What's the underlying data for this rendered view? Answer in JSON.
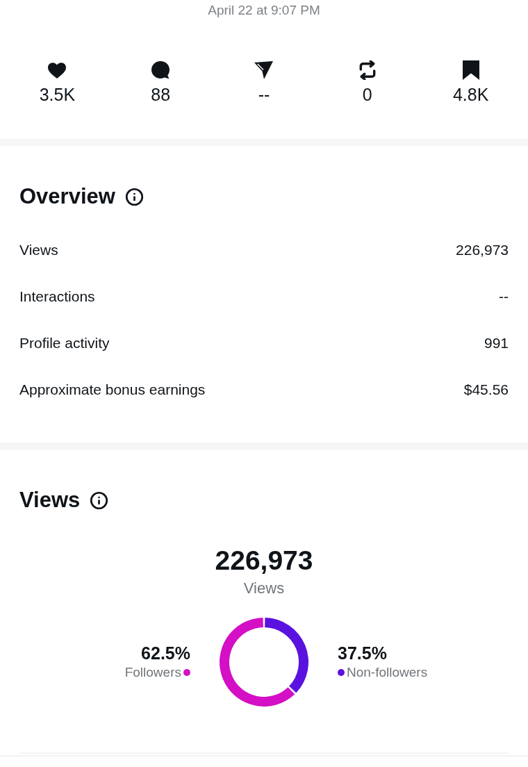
{
  "post_time": "April 22 at 9:07 PM",
  "stats": [
    {
      "kind": "likes",
      "value": "3.5K"
    },
    {
      "kind": "comments",
      "value": "88"
    },
    {
      "kind": "shares",
      "value": "--"
    },
    {
      "kind": "reposts",
      "value": "0"
    },
    {
      "kind": "saves",
      "value": "4.8K"
    }
  ],
  "overview": {
    "title": "Overview",
    "rows": [
      {
        "label": "Views",
        "value": "226,973"
      },
      {
        "label": "Interactions",
        "value": "--"
      },
      {
        "label": "Profile activity",
        "value": "991"
      },
      {
        "label": "Approximate bonus earnings",
        "value": "$45.56"
      }
    ]
  },
  "views": {
    "title": "Views",
    "total": "226,973",
    "chart_data": {
      "type": "donut",
      "categories": [
        "Followers",
        "Non-followers"
      ],
      "series": [
        {
          "name": "Views",
          "values": [
            62.5,
            37.5
          ]
        }
      ]
    },
    "legend": [
      {
        "percent": "62.5%",
        "color": "#d40fc6"
      },
      {
        "percent": "37.5%",
        "color": "#5a12de"
      }
    ]
  }
}
